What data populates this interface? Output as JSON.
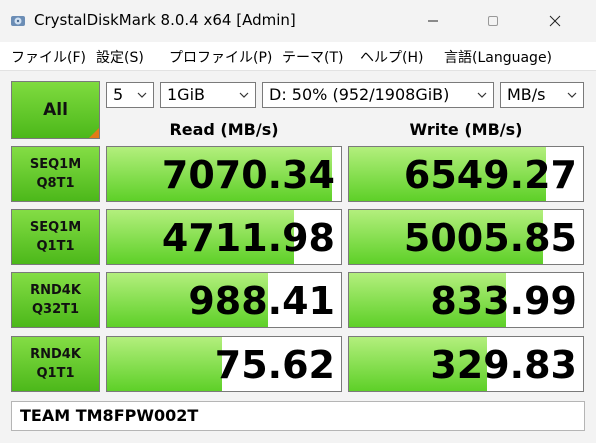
{
  "window": {
    "title": "CrystalDiskMark 8.0.4 x64 [Admin]",
    "icon": "app-disk-icon"
  },
  "menu": [
    "ファイル(F)",
    "設定(S)",
    "プロファイル(P)",
    "テーマ(T)",
    "ヘルプ(H)",
    "言語(Language)"
  ],
  "controls": {
    "all_label": "All",
    "count": "5",
    "size": "1GiB",
    "drive": "D: 50% (952/1908GiB)",
    "unit": "MB/s"
  },
  "headers": {
    "read": "Read (MB/s)",
    "write": "Write (MB/s)"
  },
  "rows": [
    {
      "line1": "SEQ1M",
      "line2": "Q8T1",
      "read": "7070.34",
      "write": "6549.27",
      "read_fill": 0.96,
      "write_fill": 0.84
    },
    {
      "line1": "SEQ1M",
      "line2": "Q1T1",
      "read": "4711.98",
      "write": "5005.85",
      "read_fill": 0.8,
      "write_fill": 0.83
    },
    {
      "line1": "RND4K",
      "line2": "Q32T1",
      "read": "988.41",
      "write": "833.99",
      "read_fill": 0.69,
      "write_fill": 0.67
    },
    {
      "line1": "RND4K",
      "line2": "Q1T1",
      "read": "75.62",
      "write": "329.83",
      "read_fill": 0.49,
      "write_fill": 0.59
    }
  ],
  "drive_name": "TEAM TM8FPW002T",
  "colors": {
    "accent_green": "#4cb81a",
    "bar_green": "#5ed028",
    "corner_orange": "#e27b17"
  }
}
